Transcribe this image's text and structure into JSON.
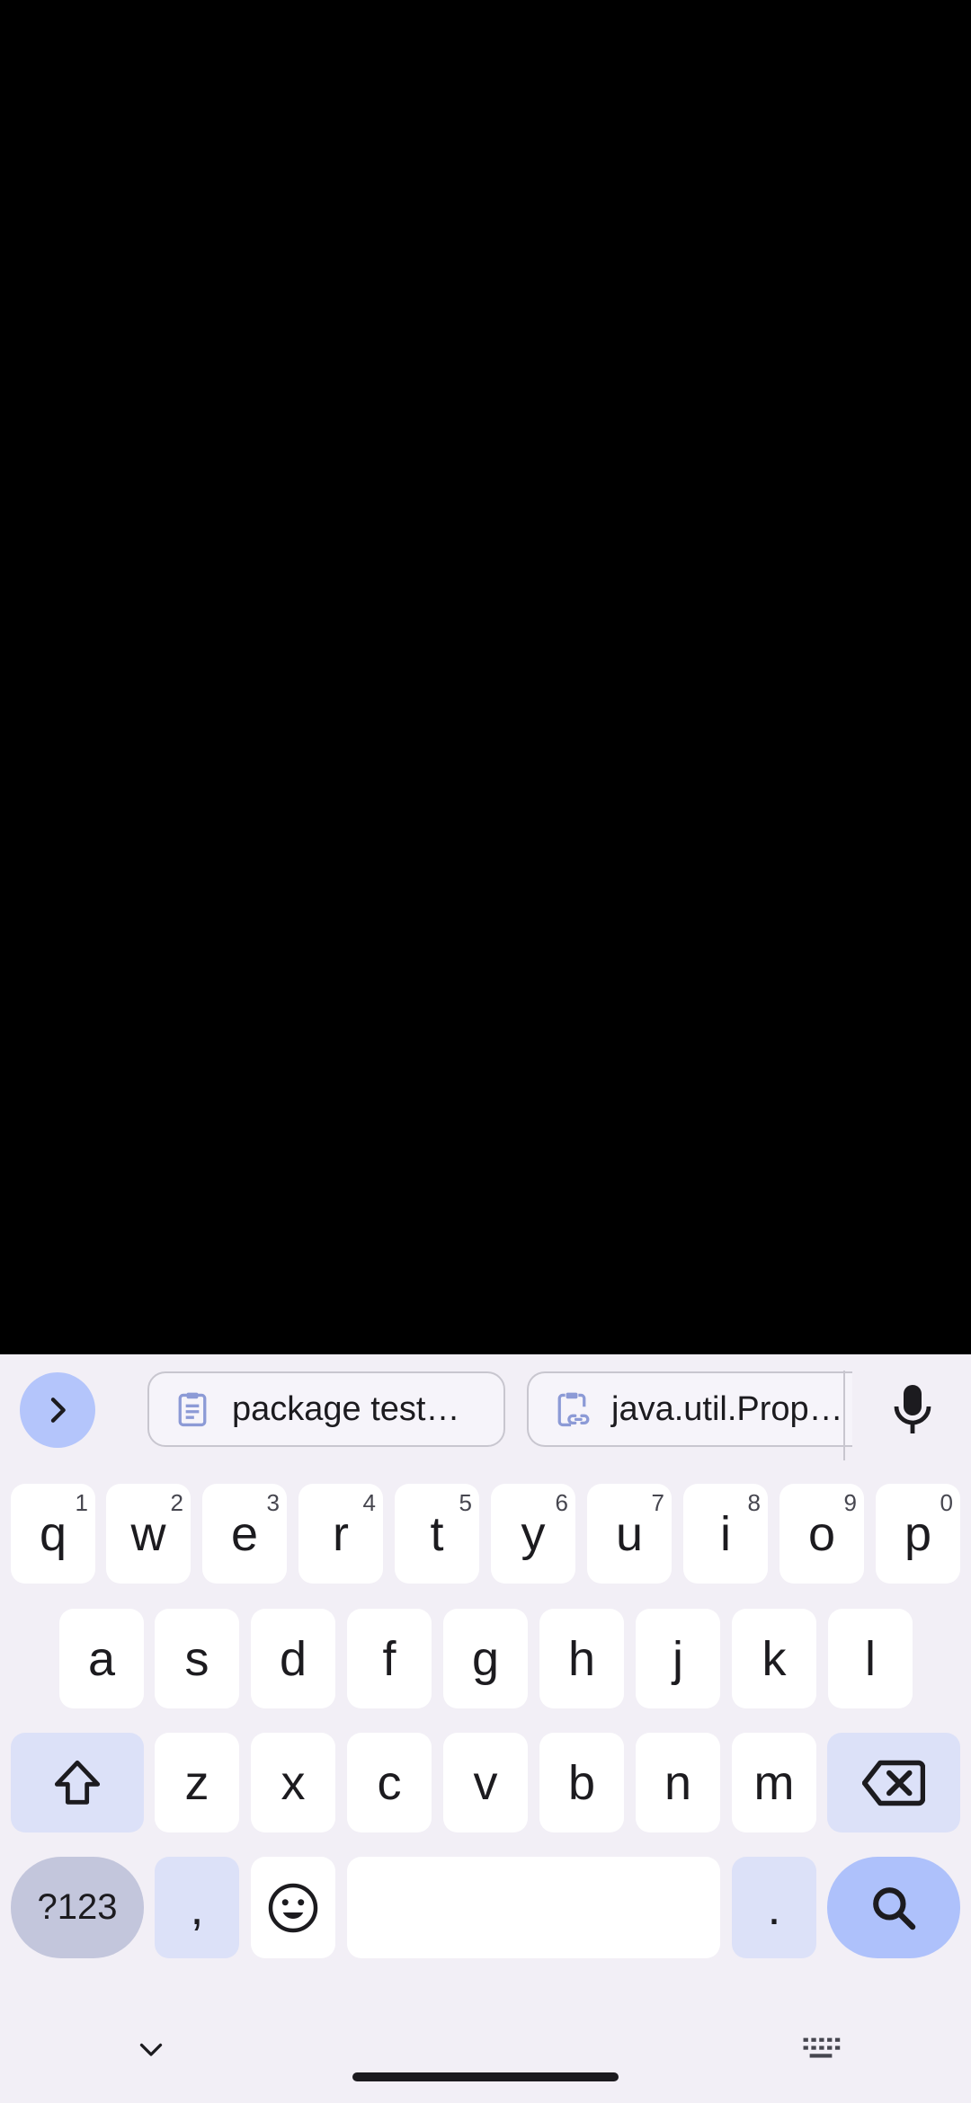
{
  "suggestions": {
    "clip_1": "package test…",
    "clip_2": "java.util.Prop…"
  },
  "keys": {
    "row1": [
      {
        "k": "q",
        "h": "1"
      },
      {
        "k": "w",
        "h": "2"
      },
      {
        "k": "e",
        "h": "3"
      },
      {
        "k": "r",
        "h": "4"
      },
      {
        "k": "t",
        "h": "5"
      },
      {
        "k": "y",
        "h": "6"
      },
      {
        "k": "u",
        "h": "7"
      },
      {
        "k": "i",
        "h": "8"
      },
      {
        "k": "o",
        "h": "9"
      },
      {
        "k": "p",
        "h": "0"
      }
    ],
    "row2": [
      "a",
      "s",
      "d",
      "f",
      "g",
      "h",
      "j",
      "k",
      "l"
    ],
    "row3": [
      "z",
      "x",
      "c",
      "v",
      "b",
      "n",
      "m"
    ],
    "symbols_label": "?123",
    "comma": ",",
    "period": "."
  },
  "colors": {
    "accent": "#aec1fb",
    "keyboard_bg": "#f2eff6",
    "modifier": "#dce1f8"
  },
  "icons": [
    "chevron-right-icon",
    "clipboard-icon",
    "clipboard-link-icon",
    "microphone-icon",
    "shift-icon",
    "backspace-icon",
    "emoji-icon",
    "search-icon",
    "chevron-down-icon",
    "keyboard-icon"
  ]
}
